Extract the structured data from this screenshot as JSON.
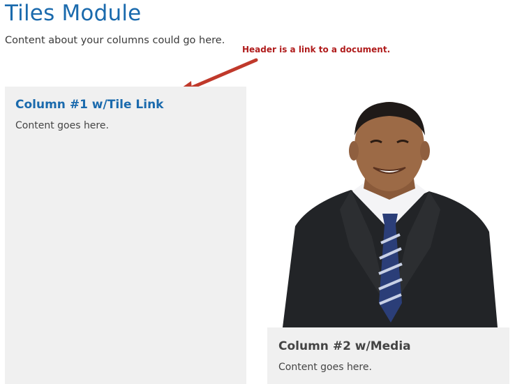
{
  "module": {
    "title": "Tiles Module",
    "intro": "Content about your columns could go here."
  },
  "annotation": {
    "note": "Header is a link to a document.",
    "color": "#b01c1c",
    "arrow_icon": "arrow-pointer-icon"
  },
  "tiles": [
    {
      "heading": "Column #1 w/Tile Link",
      "content": "Content goes here.",
      "heading_is_link": true
    },
    {
      "heading": "Column #2 w/Media",
      "content": "Content goes here.",
      "media": "person-photo"
    }
  ],
  "colors": {
    "link_blue": "#1a6aad",
    "tile_background": "#f0f0f0",
    "body_text": "#444444"
  }
}
